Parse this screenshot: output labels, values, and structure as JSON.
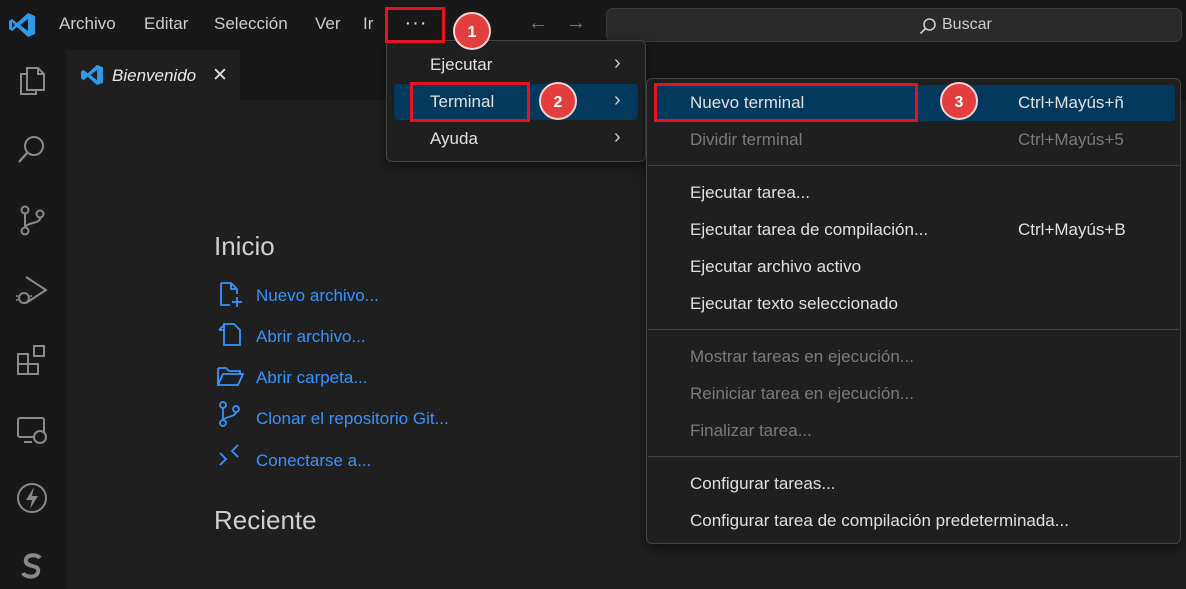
{
  "menubar": {
    "items": [
      "Archivo",
      "Editar",
      "Selección",
      "Ver",
      "Ir"
    ],
    "more_label": "···",
    "search_label": "Buscar"
  },
  "tab": {
    "label": "Bienvenido",
    "close": "✕"
  },
  "welcome": {
    "start_heading": "Inicio",
    "links": [
      "Nuevo archivo...",
      "Abrir archivo...",
      "Abrir carpeta...",
      "Clonar el repositorio Git...",
      "Conectarse a..."
    ],
    "recent_heading": "Reciente"
  },
  "more_menu": {
    "items": [
      {
        "label": "Ejecutar",
        "selected": false
      },
      {
        "label": "Terminal",
        "selected": true
      },
      {
        "label": "Ayuda",
        "selected": false
      }
    ]
  },
  "terminal_menu": {
    "items": [
      {
        "label": "Nuevo terminal",
        "shortcut": "Ctrl+Mayús+ñ",
        "selected": true,
        "enabled": true
      },
      {
        "label": "Dividir terminal",
        "shortcut": "Ctrl+Mayús+5",
        "selected": false,
        "enabled": false
      },
      {
        "label": "Ejecutar tarea...",
        "shortcut": "",
        "enabled": true
      },
      {
        "label": "Ejecutar tarea de compilación...",
        "shortcut": "Ctrl+Mayús+B",
        "enabled": true
      },
      {
        "label": "Ejecutar archivo activo",
        "shortcut": "",
        "enabled": true
      },
      {
        "label": "Ejecutar texto seleccionado",
        "shortcut": "",
        "enabled": true
      },
      {
        "label": "Mostrar tareas en ejecución...",
        "shortcut": "",
        "enabled": false
      },
      {
        "label": "Reiniciar tarea en ejecución...",
        "shortcut": "",
        "enabled": false
      },
      {
        "label": "Finalizar tarea...",
        "shortcut": "",
        "enabled": false
      },
      {
        "label": "Configurar tareas...",
        "shortcut": "",
        "enabled": true
      },
      {
        "label": "Configurar tarea de compilación predeterminada...",
        "shortcut": "",
        "enabled": true
      }
    ]
  },
  "annotations": {
    "step1": "1",
    "step2": "2",
    "step3": "3",
    "highlight_color": "#e81123"
  },
  "colors": {
    "accent": "#3794ff",
    "selection": "#04395e",
    "badge": "#e33e3e"
  }
}
